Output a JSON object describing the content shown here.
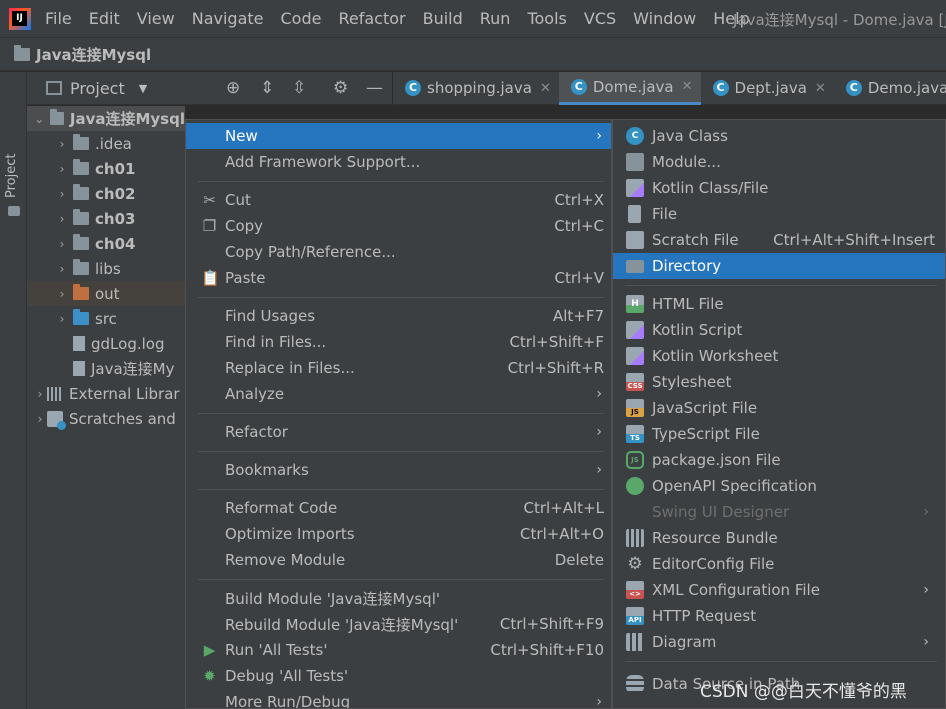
{
  "menubar": {
    "items": [
      "File",
      "Edit",
      "View",
      "Navigate",
      "Code",
      "Refactor",
      "Build",
      "Run",
      "Tools",
      "VCS",
      "Window",
      "Help"
    ],
    "window_title": "Java连接Mysql - Dome.java [Ja"
  },
  "navbar": {
    "project": "Java连接Mysql"
  },
  "sidebar": {
    "label": "Project"
  },
  "project_panel": {
    "title": "Project"
  },
  "tabs": [
    {
      "label": "shopping.java",
      "active": false
    },
    {
      "label": "Dome.java",
      "active": true
    },
    {
      "label": "Dept.java",
      "active": false
    },
    {
      "label": "Demo.java",
      "active": false
    }
  ],
  "tree": [
    {
      "label": "Java连接Mysql",
      "level": 0,
      "bold": true,
      "expanded": true,
      "icon": "module"
    },
    {
      "label": ".idea",
      "level": 1,
      "bold": false,
      "icon": "folder"
    },
    {
      "label": "ch01",
      "level": 1,
      "bold": true,
      "icon": "folder"
    },
    {
      "label": "ch02",
      "level": 1,
      "bold": true,
      "icon": "folder"
    },
    {
      "label": "ch03",
      "level": 1,
      "bold": true,
      "icon": "folder"
    },
    {
      "label": "ch04",
      "level": 1,
      "bold": true,
      "icon": "folder"
    },
    {
      "label": "libs",
      "level": 1,
      "bold": false,
      "icon": "folder"
    },
    {
      "label": "out",
      "level": 1,
      "bold": false,
      "icon": "folder-orange"
    },
    {
      "label": "src",
      "level": 1,
      "bold": false,
      "icon": "folder-blue"
    },
    {
      "label": "gdLog.log",
      "level": 1,
      "bold": false,
      "icon": "file"
    },
    {
      "label": "Java连接My",
      "level": 1,
      "bold": false,
      "icon": "file"
    },
    {
      "label": "External Librar",
      "level": 0,
      "bold": false,
      "icon": "library"
    },
    {
      "label": "Scratches and",
      "level": 0,
      "bold": false,
      "icon": "scratches"
    }
  ],
  "context_menu": [
    {
      "label": "New",
      "shortcut": "",
      "submenu": true,
      "icon": ""
    },
    {
      "label": "Add Framework Support...",
      "shortcut": "",
      "submenu": false,
      "icon": ""
    },
    {
      "label": "Cut",
      "shortcut": "Ctrl+X",
      "submenu": false,
      "icon": "scissors-icon"
    },
    {
      "label": "Copy",
      "shortcut": "Ctrl+C",
      "submenu": false,
      "icon": "copy-icon"
    },
    {
      "label": "Copy Path/Reference...",
      "shortcut": "",
      "submenu": false,
      "icon": ""
    },
    {
      "label": "Paste",
      "shortcut": "Ctrl+V",
      "submenu": false,
      "icon": "paste-icon"
    },
    {
      "label": "Find Usages",
      "shortcut": "Alt+F7",
      "submenu": false,
      "icon": ""
    },
    {
      "label": "Find in Files...",
      "shortcut": "Ctrl+Shift+F",
      "submenu": false,
      "icon": ""
    },
    {
      "label": "Replace in Files...",
      "shortcut": "Ctrl+Shift+R",
      "submenu": false,
      "icon": ""
    },
    {
      "label": "Analyze",
      "shortcut": "",
      "submenu": true,
      "icon": ""
    },
    {
      "label": "Refactor",
      "shortcut": "",
      "submenu": true,
      "icon": ""
    },
    {
      "label": "Bookmarks",
      "shortcut": "",
      "submenu": true,
      "icon": ""
    },
    {
      "label": "Reformat Code",
      "shortcut": "Ctrl+Alt+L",
      "submenu": false,
      "icon": ""
    },
    {
      "label": "Optimize Imports",
      "shortcut": "Ctrl+Alt+O",
      "submenu": false,
      "icon": ""
    },
    {
      "label": "Remove Module",
      "shortcut": "Delete",
      "submenu": false,
      "icon": ""
    },
    {
      "label": "Build Module 'Java连接Mysql'",
      "shortcut": "",
      "submenu": false,
      "icon": ""
    },
    {
      "label": "Rebuild Module 'Java连接Mysql'",
      "shortcut": "Ctrl+Shift+F9",
      "submenu": false,
      "icon": ""
    },
    {
      "label": "Run 'All Tests'",
      "shortcut": "Ctrl+Shift+F10",
      "submenu": false,
      "icon": "run-icon"
    },
    {
      "label": "Debug 'All Tests'",
      "shortcut": "",
      "submenu": false,
      "icon": "debug-icon"
    },
    {
      "label": "More Run/Debug",
      "shortcut": "",
      "submenu": true,
      "icon": ""
    }
  ],
  "new_submenu": [
    {
      "label": "Java Class",
      "shortcut": "",
      "icon": "java-class-icon",
      "badge": "C"
    },
    {
      "label": "Module...",
      "shortcut": "",
      "icon": "module-icon",
      "badge": ""
    },
    {
      "label": "Kotlin Class/File",
      "shortcut": "",
      "icon": "kotlin-file-icon",
      "badge": ""
    },
    {
      "label": "File",
      "shortcut": "",
      "icon": "file-icon",
      "badge": ""
    },
    {
      "label": "Scratch File",
      "shortcut": "Ctrl+Alt+Shift+Insert",
      "icon": "scratch-file-icon",
      "badge": ""
    },
    {
      "label": "Directory",
      "shortcut": "",
      "icon": "directory-icon",
      "badge": ""
    },
    {
      "label": "HTML File",
      "shortcut": "",
      "icon": "html-file-icon",
      "badge": "H"
    },
    {
      "label": "Kotlin Script",
      "shortcut": "",
      "icon": "kotlin-script-icon",
      "badge": ""
    },
    {
      "label": "Kotlin Worksheet",
      "shortcut": "",
      "icon": "kotlin-worksheet-icon",
      "badge": ""
    },
    {
      "label": "Stylesheet",
      "shortcut": "",
      "icon": "css-icon",
      "badge": "CSS"
    },
    {
      "label": "JavaScript File",
      "shortcut": "",
      "icon": "js-icon",
      "badge": "JS"
    },
    {
      "label": "TypeScript File",
      "shortcut": "",
      "icon": "ts-icon",
      "badge": "TS"
    },
    {
      "label": "package.json File",
      "shortcut": "",
      "icon": "nodejs-icon",
      "badge": "JS"
    },
    {
      "label": "OpenAPI Specification",
      "shortcut": "",
      "icon": "openapi-icon",
      "badge": ""
    },
    {
      "label": "Swing UI Designer",
      "shortcut": "",
      "icon": "",
      "badge": "",
      "disabled": true,
      "submenu": true
    },
    {
      "label": "Resource Bundle",
      "shortcut": "",
      "icon": "resource-bundle-icon",
      "badge": ""
    },
    {
      "label": "EditorConfig File",
      "shortcut": "",
      "icon": "gear-icon",
      "badge": ""
    },
    {
      "label": "XML Configuration File",
      "shortcut": "",
      "icon": "xml-icon",
      "badge": "<>",
      "submenu": true
    },
    {
      "label": "HTTP Request",
      "shortcut": "",
      "icon": "api-icon",
      "badge": "API"
    },
    {
      "label": "Diagram",
      "shortcut": "",
      "icon": "diagram-icon",
      "badge": "",
      "submenu": true
    },
    {
      "label": "Data Source in Path",
      "shortcut": "",
      "icon": "database-icon",
      "badge": ""
    }
  ],
  "watermark": "CSDN @@白天不懂爷的黑",
  "colors": {
    "selection": "#2675bf",
    "panel": "#3c3f41",
    "editor": "#2b2b2b"
  }
}
